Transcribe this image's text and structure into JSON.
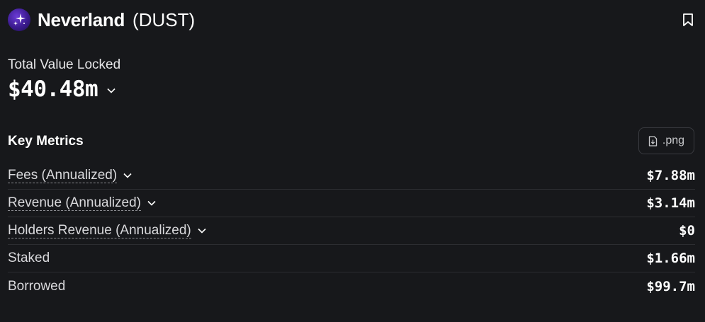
{
  "header": {
    "name": "Neverland",
    "ticker": "(DUST)",
    "logo_icon": "neverland-logo-icon",
    "bookmark_icon": "bookmark-icon"
  },
  "tvl": {
    "label": "Total Value Locked",
    "value": "$40.48m"
  },
  "key_metrics": {
    "title": "Key Metrics",
    "export_label": ".png",
    "rows": [
      {
        "label": "Fees (Annualized)",
        "value": "$7.88m",
        "expandable": true
      },
      {
        "label": "Revenue (Annualized)",
        "value": "$3.14m",
        "expandable": true
      },
      {
        "label": "Holders Revenue (Annualized)",
        "value": "$0",
        "expandable": true
      },
      {
        "label": "Staked",
        "value": "$1.66m",
        "expandable": false
      },
      {
        "label": "Borrowed",
        "value": "$99.7m",
        "expandable": false
      }
    ]
  },
  "colors": {
    "background": "#17181b",
    "text": "#ffffff",
    "muted": "#d9d9dc",
    "divider": "#2c2d31",
    "logo": "#4b26b0"
  }
}
